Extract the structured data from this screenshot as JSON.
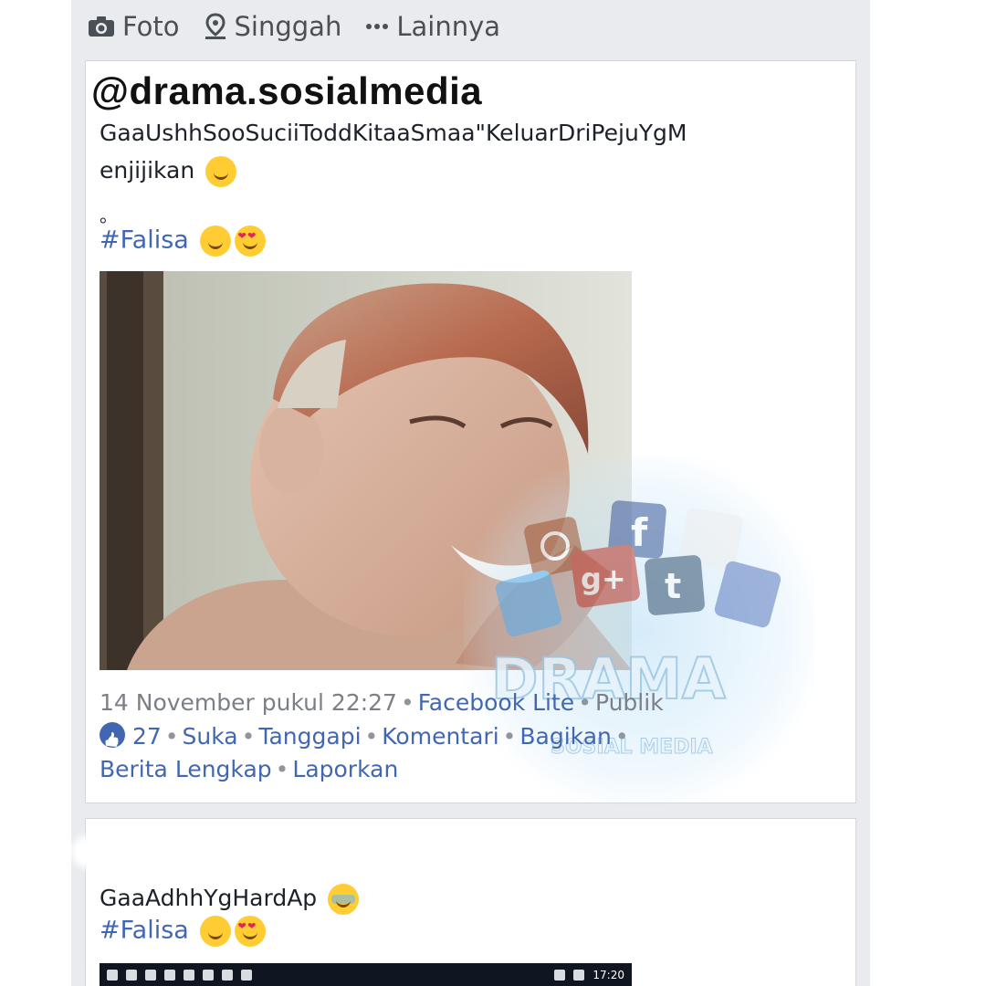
{
  "composer": {
    "photo_label": "Foto",
    "checkin_label": "Singgah",
    "more_label": "Lainnya"
  },
  "watermark": {
    "handle": "@drama.sosialmedia",
    "logo_text": "DRAMA",
    "logo_subtext": "SOSIAL MEDIA"
  },
  "post1": {
    "text_line_1": "GaaUshhSooSuciiToddKitaaSmaa\"KeluarDriPejuYgM",
    "text_line_2": "enjijikan",
    "text_line_3": "。",
    "hashtag": "#Falisa",
    "timestamp": "14 November pukul 22:27",
    "via": "Facebook Lite",
    "privacy": "Publik",
    "like_count": "27",
    "actions": [
      "Suka",
      "Tanggapi",
      "Komentari",
      "Bagikan",
      "Berita Lengkap",
      "Laporkan"
    ]
  },
  "post2": {
    "text": "GaaAdhhYgHardAp",
    "hashtag": "#Falisa",
    "video_clock": "17:20"
  },
  "colors": {
    "link_blue": "#4267b2",
    "feed_bg": "#e9ebee",
    "text_dark": "#1d2129"
  }
}
